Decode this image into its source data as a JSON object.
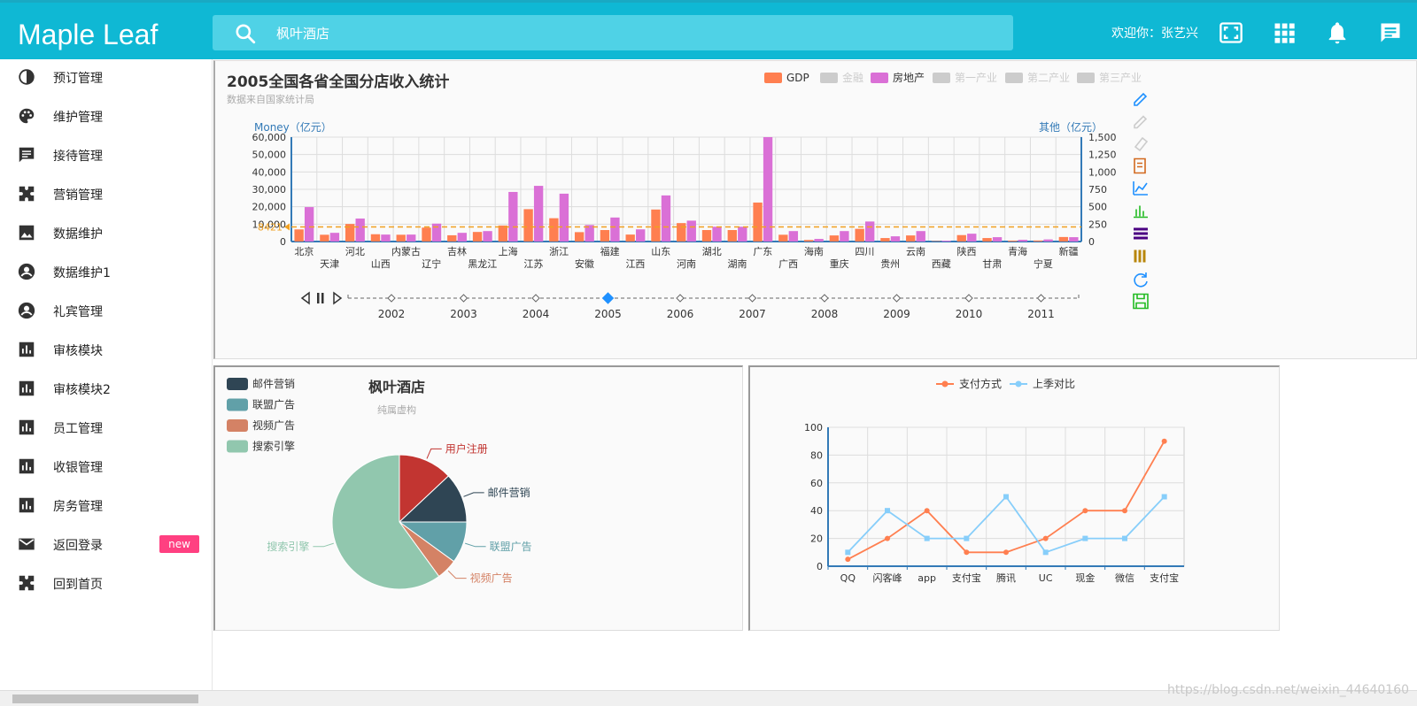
{
  "header": {
    "brand": "Maple Leaf",
    "search_value": "枫叶酒店",
    "welcome": "欢迎你：张艺兴",
    "icons": [
      "fullscreen-icon",
      "apps-grid-icon",
      "bell-icon",
      "message-icon"
    ],
    "colors": {
      "topbar": "#0fb8d4",
      "search": "#4fd2e6"
    }
  },
  "sidebar": {
    "items": [
      {
        "label": "预订管理",
        "icon": "contrast-icon"
      },
      {
        "label": "维护管理",
        "icon": "palette-icon"
      },
      {
        "label": "接待管理",
        "icon": "chat-icon"
      },
      {
        "label": "营销管理",
        "icon": "puzzle-icon"
      },
      {
        "label": "数据维护",
        "icon": "image-icon"
      },
      {
        "label": "数据维护1",
        "icon": "account-circle-icon"
      },
      {
        "label": "礼宾管理",
        "icon": "account-circle-icon"
      },
      {
        "label": "审核模块",
        "icon": "bar-chart-icon"
      },
      {
        "label": "审核模块2",
        "icon": "bar-chart-icon"
      },
      {
        "label": "员工管理",
        "icon": "bar-chart-icon"
      },
      {
        "label": "收银管理",
        "icon": "bar-chart-icon"
      },
      {
        "label": "房务管理",
        "icon": "bar-chart-icon"
      },
      {
        "label": "返回登录",
        "icon": "mail-icon",
        "badge": "new"
      },
      {
        "label": "回到首页",
        "icon": "puzzle-icon"
      }
    ]
  },
  "bar_panel": {
    "title": "2005全国各省全国分店收入统计",
    "subtitle": "数据来自国家统计局",
    "legend": [
      {
        "label": "GDP",
        "color": "#ff7f50",
        "active": true
      },
      {
        "label": "金融",
        "color": "#cccccc",
        "active": false
      },
      {
        "label": "房地产",
        "color": "#da70d6",
        "active": true
      },
      {
        "label": "第一产业",
        "color": "#cccccc",
        "active": false
      },
      {
        "label": "第二产业",
        "color": "#cccccc",
        "active": false
      },
      {
        "label": "第三产业",
        "color": "#cccccc",
        "active": false
      }
    ],
    "markline_label": "8421",
    "timeline": [
      "2002",
      "2003",
      "2004",
      "2005",
      "2006",
      "2007",
      "2008",
      "2009",
      "2010",
      "2011"
    ],
    "timeline_current": "2005",
    "toolbox": [
      "mark-pen-icon",
      "mark-undo-icon",
      "mark-clear-icon",
      "data-view-icon",
      "line-chart-icon",
      "bar-chart-icon",
      "stack-icon",
      "tiled-icon",
      "refresh-icon",
      "save-icon"
    ]
  },
  "pie_panel": {
    "title": "枫叶酒店",
    "subtitle": "纯属虚构",
    "legend": [
      {
        "label": "邮件营销",
        "color": "#2f4554"
      },
      {
        "label": "联盟广告",
        "color": "#61a0a8"
      },
      {
        "label": "视频广告",
        "color": "#d48265"
      },
      {
        "label": "搜索引擎",
        "color": "#91c7ae"
      }
    ]
  },
  "line_panel": {
    "legend": [
      {
        "label": "支付方式",
        "color": "#ff7f50"
      },
      {
        "label": "上季对比",
        "color": "#87cefa"
      }
    ]
  },
  "watermark": "https://blog.csdn.net/weixin_44640160",
  "chart_data": [
    {
      "type": "bar",
      "title": "2005全国各省全国分店收入统计",
      "subtitle": "数据来自国家统计局",
      "ylabel": "Money（亿元）",
      "ylabel_right": "其他（亿元）",
      "ylim": [
        0,
        60000
      ],
      "yticks": [
        "0",
        "10,000",
        "20,000",
        "30,000",
        "40,000",
        "50,000",
        "60,000"
      ],
      "ylim_right": [
        0,
        1500
      ],
      "yticks_right": [
        "0",
        "250",
        "500",
        "750",
        "1,000",
        "1,250",
        "1,500"
      ],
      "categories": [
        "北京",
        "天津",
        "河北",
        "山西",
        "内蒙古",
        "辽宁",
        "吉林",
        "黑龙江",
        "上海",
        "江苏",
        "浙江",
        "安徽",
        "福建",
        "江西",
        "山东",
        "河南",
        "湖北",
        "湖南",
        "广东",
        "广西",
        "海南",
        "重庆",
        "四川",
        "贵州",
        "云南",
        "西藏",
        "陕西",
        "甘肃",
        "青海",
        "宁夏",
        "新疆"
      ],
      "series": [
        {
          "name": "GDP",
          "color": "#ff7f50",
          "values": [
            6970,
            3900,
            10100,
            4200,
            3900,
            8000,
            3600,
            5500,
            9200,
            18600,
            13400,
            5400,
            6600,
            4000,
            18400,
            10600,
            6600,
            6600,
            22400,
            3900,
            900,
            3500,
            7300,
            2000,
            3500,
            250,
            3700,
            2000,
            550,
            600,
            2600
          ]
        },
        {
          "name": "房地产",
          "color": "#da70d6",
          "values": [
            19800,
            5000,
            13200,
            4000,
            4000,
            10300,
            5000,
            6000,
            28500,
            32000,
            27500,
            9500,
            13800,
            7000,
            26500,
            12000,
            8500,
            8500,
            60000,
            6000,
            1500,
            6000,
            11500,
            3000,
            6000,
            500,
            4500,
            2500,
            1000,
            1200,
            2500
          ]
        }
      ],
      "markline": {
        "label": "8421",
        "value": 8421
      },
      "legend_placement": "top-right",
      "grid": true
    },
    {
      "type": "pie",
      "title": "枫叶酒店",
      "subtitle": "纯属虚构",
      "labels": [
        "用户注册",
        "邮件营销",
        "联盟广告",
        "视频广告",
        "搜索引擎"
      ],
      "values": [
        13,
        12,
        10,
        5,
        60
      ],
      "colors": [
        "#c23531",
        "#2f4554",
        "#61a0a8",
        "#d48265",
        "#91c7ae"
      ],
      "legend_placement": "top-left"
    },
    {
      "type": "line",
      "categories": [
        "QQ",
        "闪客峰",
        "app",
        "支付宝",
        "腾讯",
        "UC",
        "现金",
        "微信",
        "支付宝"
      ],
      "series": [
        {
          "name": "支付方式",
          "color": "#ff7f50",
          "values": [
            5,
            20,
            40,
            10,
            10,
            20,
            40,
            40,
            90
          ]
        },
        {
          "name": "上季对比",
          "color": "#87cefa",
          "values": [
            10,
            40,
            20,
            20,
            50,
            10,
            20,
            20,
            50
          ]
        }
      ],
      "ylim": [
        0,
        100
      ],
      "yticks": [
        "0",
        "20",
        "40",
        "60",
        "80",
        "100"
      ],
      "legend_placement": "top-center",
      "grid": true
    }
  ]
}
